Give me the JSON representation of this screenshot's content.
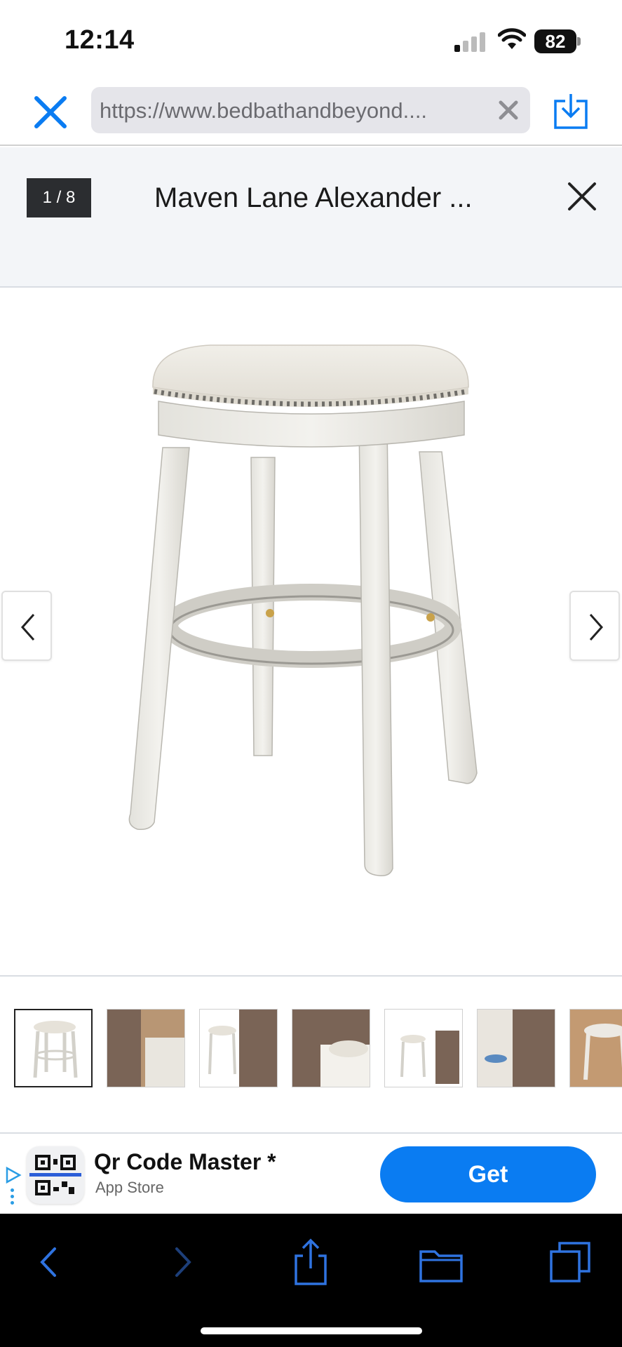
{
  "status_bar": {
    "time": "12:14",
    "battery": "82",
    "icons": [
      "cellular-signal-icon",
      "wifi-icon",
      "battery-icon"
    ]
  },
  "browser": {
    "url": "https://www.bedbathandbeyond....",
    "icons": [
      "close-icon",
      "clear-icon",
      "download-icon"
    ],
    "accent_color": "#0a7cf2"
  },
  "gallery": {
    "counter": "1 / 8",
    "title": "Maven Lane Alexander ...",
    "icons": [
      "close-icon",
      "chevron-left-icon",
      "chevron-right-icon"
    ],
    "selected_index": 1,
    "thumbnails": [
      {
        "kind": "product-photo"
      },
      {
        "kind": "lifestyle-infographic"
      },
      {
        "kind": "dedicated-to-details"
      },
      {
        "kind": "impeccably-crafted"
      },
      {
        "kind": "specifications"
      },
      {
        "kind": "design-meets-artistry"
      },
      {
        "kind": "lifestyle-photo"
      }
    ]
  },
  "banner": {
    "app_name": "Qr Code Master *",
    "store": "App Store",
    "cta": "Get",
    "icons": [
      "ad-play-icon",
      "qr-code-icon"
    ]
  },
  "toolbar": {
    "icons": [
      "back-icon",
      "forward-icon",
      "share-icon",
      "bookmarks-icon",
      "tabs-icon"
    ]
  }
}
